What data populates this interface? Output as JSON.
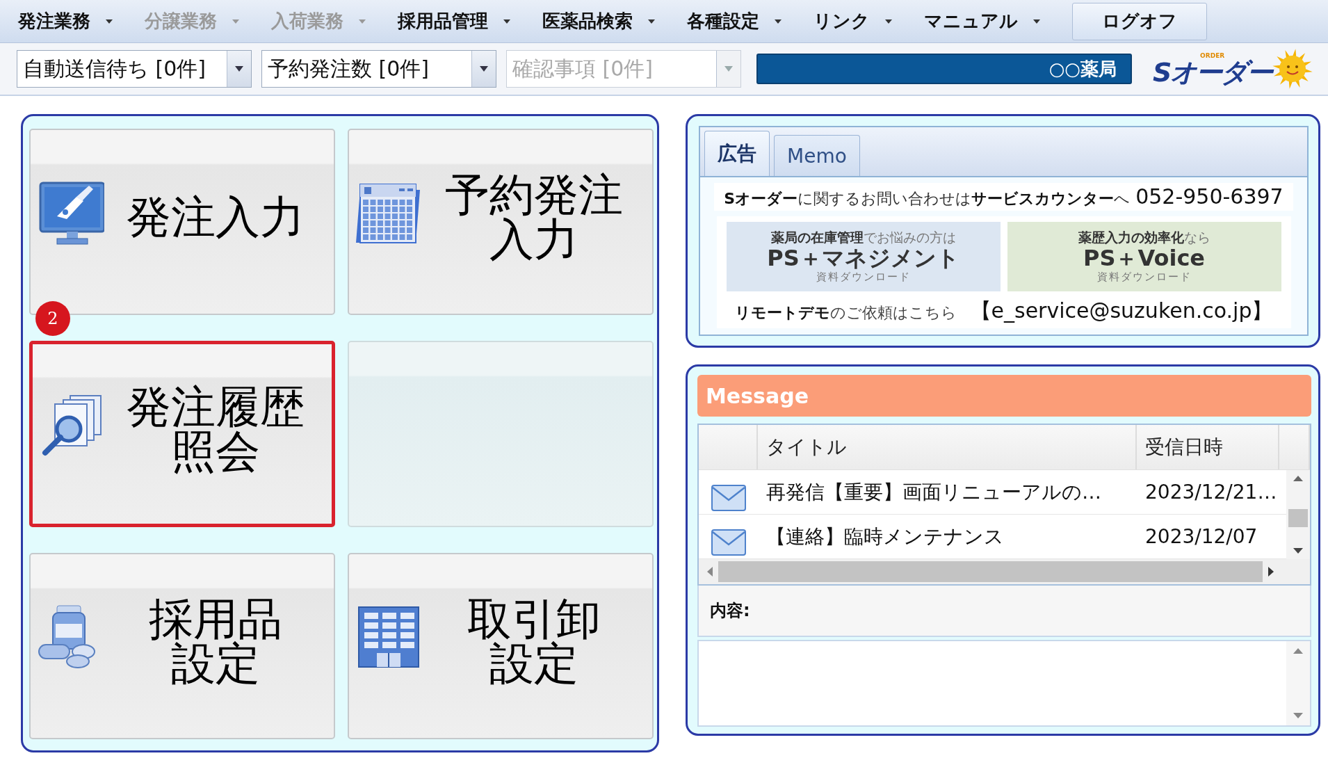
{
  "menu_bar": {
    "items": [
      {
        "kind": "menu",
        "label": "発注業務",
        "disabled": false
      },
      {
        "kind": "menu",
        "label": "分譲業務",
        "disabled": true
      },
      {
        "kind": "menu",
        "label": "入荷業務",
        "disabled": true
      },
      {
        "kind": "menu",
        "label": "採用品管理",
        "disabled": false
      },
      {
        "kind": "menu",
        "label": "医薬品検索",
        "disabled": false
      },
      {
        "kind": "menu",
        "label": "各種設定",
        "disabled": false
      },
      {
        "kind": "menu",
        "label": "リンク",
        "disabled": false
      },
      {
        "kind": "menu",
        "label": "マニュアル",
        "disabled": false
      },
      {
        "kind": "button",
        "label": "ログオフ",
        "disabled": false
      }
    ]
  },
  "toolbar": {
    "dropdowns": [
      {
        "value": "自動送信待ち [0件]",
        "disabled": false
      },
      {
        "value": "予約発注数 [0件]",
        "disabled": false
      },
      {
        "value": "確認事項 [0件]",
        "disabled": true
      }
    ],
    "pharmacy_name": "○○薬局",
    "logo": {
      "small": "ORDER",
      "text": "Sオーダー"
    }
  },
  "tiles": [
    {
      "kind": "menu",
      "label_lines": [
        "発注入力"
      ],
      "highlighted": false
    },
    {
      "kind": "menu",
      "label_lines": [
        "予約発注",
        "入力"
      ],
      "highlighted": false
    },
    {
      "kind": "menu",
      "label_lines": [
        "発注履歴",
        "照会"
      ],
      "highlighted": true,
      "badge": "2"
    },
    {
      "kind": "empty",
      "highlighted": false
    },
    {
      "kind": "menu",
      "label_lines": [
        "採用品",
        "設定"
      ],
      "highlighted": false
    },
    {
      "kind": "menu",
      "label_lines": [
        "取引卸",
        "設定"
      ],
      "highlighted": false
    }
  ],
  "info_panel": {
    "tabs": [
      {
        "label": "広告",
        "selected": true
      },
      {
        "label": "Memo",
        "selected": false
      }
    ],
    "contact": {
      "text": "**Sオーダー**に関するお問い合わせは**サービスカウンター**へ",
      "phone": "052-950-6397"
    },
    "banners": [
      {
        "heading": "**薬局の在庫管理**でお悩みの方は",
        "title": "PS＋マネジメント",
        "link": "資料ダウンロード",
        "color": "#dce6f2"
      },
      {
        "heading": "**薬歴入力の効率化**なら",
        "title": "PS＋Voice",
        "link": "資料ダウンロード",
        "color": "#e0ead6"
      }
    ],
    "demo": {
      "text": "**リモートデモ**のご依頼はこちら",
      "email": "【e_service@suzuken.co.jp】"
    }
  },
  "message_panel": {
    "title": "Message",
    "columns": [
      "タイトル",
      "受信日時"
    ],
    "rows": [
      {
        "title": "再発信【重要】画面リニューアルの…",
        "date": "2023/12/21…"
      },
      {
        "title": "【連絡】臨時メンテナンス",
        "date": "2023/12/07"
      }
    ],
    "content_label": "内容:"
  }
}
